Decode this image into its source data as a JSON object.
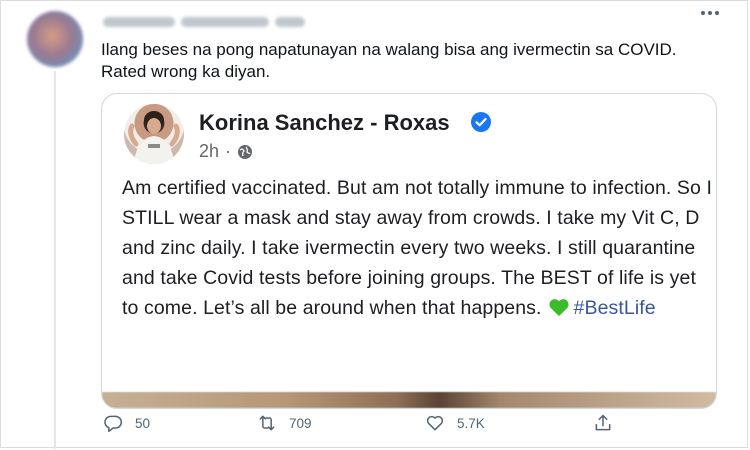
{
  "tweet": {
    "text": "Ilang beses na pong napatunayan na walang bisa ang ivermectin sa COVID. Rated wrong ka diyan.",
    "author_blurred": true
  },
  "quote": {
    "name": "Korina Sanchez - Roxas",
    "time": "2h",
    "separator": "·",
    "body": "Am certified vaccinated. But am not totally immune to infection. So I STILL wear a mask and stay away from crowds. I take my Vit C, D and zinc daily. I take ivermectin every two weeks. I still quarantine and take Covid tests before joining groups. The BEST of life is yet to come. Let’s all be around when that happens.",
    "hashtag": "#BestLife",
    "verified_color": "#1877f2",
    "heart_color": "#3dbb2b"
  },
  "actions": {
    "replies": "50",
    "retweets": "709",
    "likes": "5.7K"
  },
  "icons": [
    "more-icon",
    "verified-badge-icon",
    "globe-icon",
    "green-heart-icon",
    "reply-icon",
    "retweet-icon",
    "like-icon",
    "share-icon"
  ]
}
